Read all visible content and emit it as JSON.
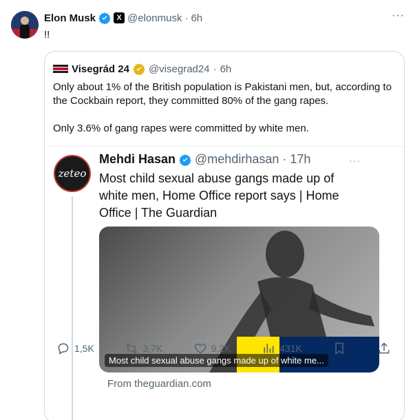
{
  "tweet": {
    "author_name": "Elon Musk",
    "handle": "@elonmusk",
    "separator": "·",
    "time": "6h",
    "x_badge": "X",
    "text": "!!",
    "more": "···"
  },
  "quote": {
    "author_name": "Visegrád 24",
    "handle": "@visegrad24",
    "separator": "·",
    "time": "6h",
    "paragraph_1": "Only about 1% of the British population is Pakistani men, but, according to the Cockbain report, they committed 80% of the gang rapes.",
    "paragraph_2": "Only 3.6% of gang rapes were committed by white men."
  },
  "inner_tweet": {
    "author_name": "Mehdi Hasan",
    "handle": "@mehdirhasan",
    "separator": "·",
    "time": "17h",
    "avatar_text": "zeteo",
    "more": "···",
    "text": "Most child sexual abuse gangs made up of white men, Home Office report says | Home Office | The Guardian",
    "media_caption": "Most child sexual abuse gangs made up of white me...",
    "from_source": "From theguardian.com"
  },
  "actions": {
    "replies": "1,5K",
    "reposts": "3,7K",
    "likes": "9,2K",
    "views": "431K"
  },
  "colors": {
    "verified_blue": "#1d9bf0",
    "verified_gold": "#e2b719",
    "text_primary": "#0f1419",
    "text_secondary": "#536471",
    "border": "#cfd9de"
  }
}
